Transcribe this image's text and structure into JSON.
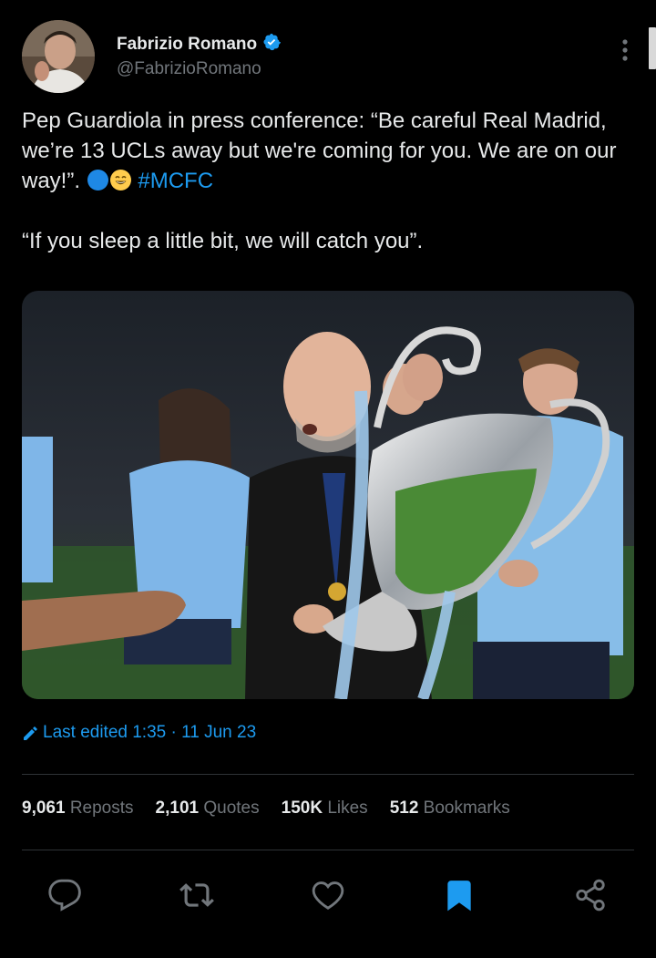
{
  "author": {
    "name": "Fabrizio Romano",
    "handle": "@FabrizioRomano",
    "verified": true
  },
  "tweet": {
    "line1": "Pep Guardiola in press conference: “Be careful Real Madrid, we’re 13 UCLs away but we're coming for you. We are on our way!”. ",
    "hashtag": "#MCFC",
    "line2": "“If you sleep a little bit, we will catch you”."
  },
  "edited": {
    "label": "Last edited 1:35 · 11 Jun 23"
  },
  "stats": {
    "reposts_count": "9,061",
    "reposts_label": "Reposts",
    "quotes_count": "2,101",
    "quotes_label": "Quotes",
    "likes_count": "150K",
    "likes_label": "Likes",
    "bookmarks_count": "512",
    "bookmarks_label": "Bookmarks"
  },
  "colors": {
    "accent": "#1d9bf0",
    "text": "#e7e9ea",
    "muted": "#71767b",
    "background": "#000000"
  },
  "icons": [
    "more-icon",
    "verified-icon",
    "pencil-icon",
    "reply-icon",
    "repost-icon",
    "like-icon",
    "bookmark-icon",
    "share-icon"
  ]
}
